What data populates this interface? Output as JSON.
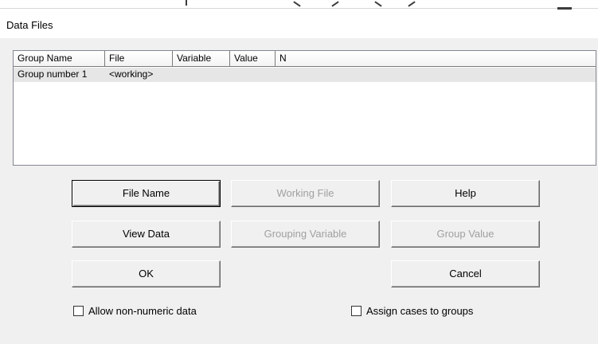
{
  "window": {
    "title": "Data Files"
  },
  "list": {
    "columns": [
      {
        "label": "Group Name"
      },
      {
        "label": "File"
      },
      {
        "label": "Variable"
      },
      {
        "label": "Value"
      },
      {
        "label": "N"
      }
    ],
    "rows": [
      {
        "group_name": "Group number 1",
        "file": "<working>",
        "variable": "",
        "value": "",
        "n": ""
      }
    ]
  },
  "buttons": {
    "file_name": "File Name",
    "working_file": "Working File",
    "help": "Help",
    "view_data": "View Data",
    "grouping_variable": "Grouping Variable",
    "group_value": "Group Value",
    "ok": "OK",
    "cancel": "Cancel"
  },
  "checkboxes": {
    "allow_non_numeric": {
      "label": "Allow non-numeric data",
      "checked": false
    },
    "assign_cases": {
      "label": "Assign cases to groups",
      "checked": false
    }
  },
  "colors": {
    "dialog_bg": "#f0f0f0",
    "selected_row": "#e6e6e6",
    "disabled_text": "#a0a0a0"
  }
}
